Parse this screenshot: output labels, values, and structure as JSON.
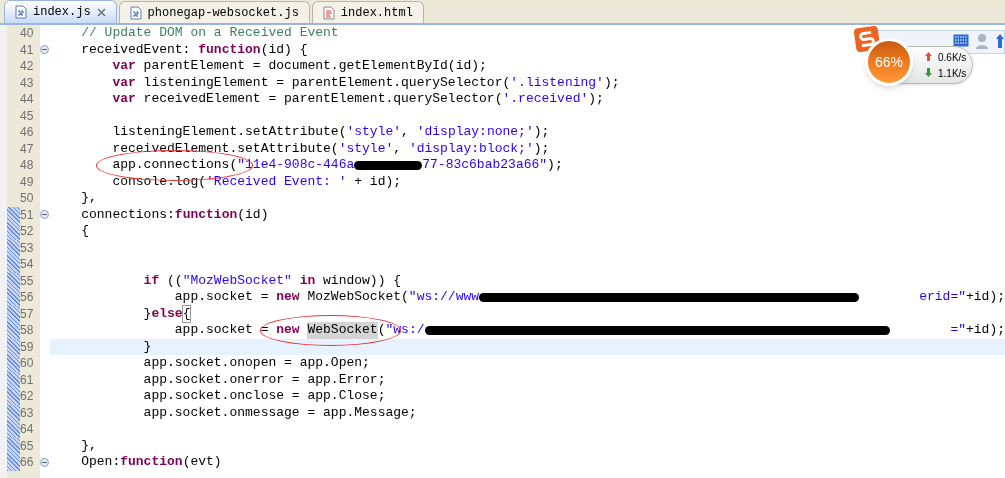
{
  "tabs": [
    {
      "label": "index.js",
      "kind": "js",
      "selected": true,
      "closable": true
    },
    {
      "label": "phonegap-websocket.js",
      "kind": "js",
      "selected": false,
      "closable": false
    },
    {
      "label": "index.html",
      "kind": "html",
      "selected": false,
      "closable": false
    }
  ],
  "editor": {
    "lines": [
      {
        "num": "40",
        "fold": false,
        "changed": false,
        "current": false,
        "tokens": [
          {
            "kind": "comment",
            "text": "// Update DOM on a Received Event"
          }
        ]
      },
      {
        "num": "41",
        "fold": true,
        "changed": false,
        "current": false,
        "tokens": [
          {
            "kind": "plain",
            "text": "receivedEvent: "
          },
          {
            "kind": "keyword",
            "text": "function"
          },
          {
            "kind": "plain",
            "text": "(id) {"
          }
        ],
        "children": [
          {
            "num": "42",
            "fold": false,
            "changed": false,
            "current": false,
            "tokens": [
              {
                "kind": "keyword",
                "text": "var"
              },
              {
                "kind": "plain",
                "text": " parentElement = document.getElementById(id);"
              }
            ]
          },
          {
            "num": "43",
            "fold": false,
            "changed": false,
            "current": false,
            "tokens": [
              {
                "kind": "keyword",
                "text": "var"
              },
              {
                "kind": "plain",
                "text": " listeningElement = parentElement.querySelector("
              },
              {
                "kind": "string",
                "text": "'.listening'"
              },
              {
                "kind": "plain",
                "text": ");"
              }
            ]
          },
          {
            "num": "44",
            "fold": false,
            "changed": false,
            "current": false,
            "tokens": [
              {
                "kind": "keyword",
                "text": "var"
              },
              {
                "kind": "plain",
                "text": " receivedElement = parentElement.querySelector("
              },
              {
                "kind": "string",
                "text": "'.received'"
              },
              {
                "kind": "plain",
                "text": ");"
              }
            ]
          },
          {
            "num": "45",
            "fold": false,
            "changed": false,
            "current": false
          },
          {
            "num": "46",
            "fold": false,
            "changed": false,
            "current": false,
            "tokens": [
              {
                "kind": "plain",
                "text": "listeningElement.setAttribute("
              },
              {
                "kind": "string",
                "text": "'style'"
              },
              {
                "kind": "plain",
                "text": ", "
              },
              {
                "kind": "string",
                "text": "'display:none;'"
              },
              {
                "kind": "plain",
                "text": ");"
              }
            ]
          },
          {
            "num": "47",
            "fold": false,
            "changed": false,
            "current": false,
            "tokens": [
              {
                "kind": "plain",
                "text": "receivedElement.setAttribute("
              },
              {
                "kind": "string",
                "text": "'style'"
              },
              {
                "kind": "plain",
                "text": ", "
              },
              {
                "kind": "string",
                "text": "'display:block;'"
              },
              {
                "kind": "plain",
                "text": ");"
              }
            ]
          },
          {
            "num": "48",
            "fold": false,
            "changed": false,
            "current": false,
            "tokens": [
              {
                "kind": "circled",
                "tokens": [
                  {
                    "kind": "plain",
                    "text": "app.connections("
                  }
                ]
              },
              {
                "kind": "string",
                "text": "\"11e4-908c-446a"
              },
              {
                "kind": "redaction-short"
              },
              {
                "kind": "string",
                "text": "77-83c6bab23a66\""
              },
              {
                "kind": "plain",
                "text": ");"
              }
            ]
          },
          {
            "num": "49",
            "fold": false,
            "changed": false,
            "current": false,
            "tokens": [
              {
                "kind": "plain",
                "text": "console.log("
              },
              {
                "kind": "string",
                "text": "'Received Event: '"
              },
              {
                "kind": "plain",
                "text": " + id);"
              }
            ]
          }
        ]
      },
      {
        "num": "50",
        "fold": false,
        "changed": false,
        "current": false,
        "tokens": [
          {
            "kind": "plain",
            "text": "},"
          }
        ]
      },
      {
        "num": "51",
        "fold": true,
        "changed": true,
        "current": false,
        "tokens": [
          {
            "kind": "plain",
            "text": "connections:"
          },
          {
            "kind": "keyword",
            "text": "function"
          },
          {
            "kind": "plain",
            "text": "(id)"
          }
        ]
      },
      {
        "num": "52",
        "fold": false,
        "changed": true,
        "current": false,
        "tokens": [
          {
            "kind": "plain",
            "text": "{"
          }
        ],
        "children": [
          {
            "num": "53",
            "fold": false,
            "changed": true,
            "current": false
          },
          {
            "num": "54",
            "fold": false,
            "changed": true,
            "current": false,
            "children": [
              {
                "num": "55",
                "fold": false,
                "changed": true,
                "current": false,
                "tokens": [
                  {
                    "kind": "keyword",
                    "text": "if"
                  },
                  {
                    "kind": "plain",
                    "text": " (("
                  },
                  {
                    "kind": "string",
                    "text": "\"MozWebSocket\""
                  },
                  {
                    "kind": "keyword",
                    "text": " in"
                  },
                  {
                    "kind": "plain",
                    "text": " window)) {"
                  }
                ],
                "children": [
                  {
                    "num": "56",
                    "fold": false,
                    "changed": true,
                    "current": false,
                    "tokens": [
                      {
                        "kind": "plain",
                        "text": "app.socket = "
                      },
                      {
                        "kind": "keyword",
                        "text": "new"
                      },
                      {
                        "kind": "plain",
                        "text": " MozWebSocket("
                      },
                      {
                        "kind": "string",
                        "text": "\"ws://www"
                      },
                      {
                        "kind": "redaction-long"
                      },
                      {
                        "kind": "string",
                        "text": "erid=\""
                      },
                      {
                        "kind": "plain",
                        "text": "+id);"
                      }
                    ]
                  }
                ]
              },
              {
                "num": "57",
                "fold": false,
                "changed": true,
                "current": false,
                "tokens": [
                  {
                    "kind": "plain",
                    "text": "}"
                  },
                  {
                    "kind": "keyword",
                    "text": "else"
                  },
                  {
                    "kind": "bracket",
                    "text": "{"
                  }
                ],
                "children": [
                  {
                    "num": "58",
                    "fold": false,
                    "changed": true,
                    "current": false,
                    "tokens": [
                      {
                        "kind": "plain",
                        "text": "app.socket = "
                      },
                      {
                        "kind": "circled",
                        "tokens": [
                          {
                            "kind": "keyword",
                            "text": "new "
                          },
                          {
                            "kind": "occurrence",
                            "text": "WebSocket"
                          },
                          {
                            "kind": "plain",
                            "text": "("
                          }
                        ]
                      },
                      {
                        "kind": "string",
                        "text": "\"ws:/"
                      },
                      {
                        "kind": "redaction-long"
                      },
                      {
                        "kind": "string",
                        "text": "=\""
                      },
                      {
                        "kind": "plain",
                        "text": "+id);"
                      }
                    ]
                  }
                ]
              },
              {
                "num": "59",
                "fold": false,
                "changed": true,
                "current": true,
                "tokens": [
                  {
                    "kind": "plain",
                    "text": "}"
                  }
                ]
              },
              {
                "num": "60",
                "fold": false,
                "changed": true,
                "current": false,
                "tokens": [
                  {
                    "kind": "plain",
                    "text": "app.socket.onopen = app.Open;"
                  }
                ]
              },
              {
                "num": "61",
                "fold": false,
                "changed": true,
                "current": false,
                "tokens": [
                  {
                    "kind": "plain",
                    "text": "app.socket.onerror = app.Error;"
                  }
                ]
              },
              {
                "num": "62",
                "fold": false,
                "changed": true,
                "current": false,
                "tokens": [
                  {
                    "kind": "plain",
                    "text": "app.socket.onclose = app.Close;"
                  }
                ]
              },
              {
                "num": "63",
                "fold": false,
                "changed": true,
                "current": false,
                "tokens": [
                  {
                    "kind": "plain",
                    "text": "app.socket.onmessage = app.Message;"
                  }
                ]
              }
            ]
          },
          {
            "num": "64",
            "fold": false,
            "changed": true,
            "current": false
          }
        ]
      },
      {
        "num": "65",
        "fold": false,
        "changed": true,
        "current": false,
        "tokens": [
          {
            "kind": "plain",
            "text": "},"
          }
        ]
      },
      {
        "num": "66",
        "fold": true,
        "changed": true,
        "current": false,
        "tokens": [
          {
            "kind": "plain",
            "text": "Open:"
          },
          {
            "kind": "keyword",
            "text": "function"
          },
          {
            "kind": "plain",
            "text": "(evt)"
          }
        ]
      }
    ]
  },
  "net_monitor": {
    "percent": "66%",
    "upload": "0.6K/s",
    "download": "1.1K/s"
  }
}
